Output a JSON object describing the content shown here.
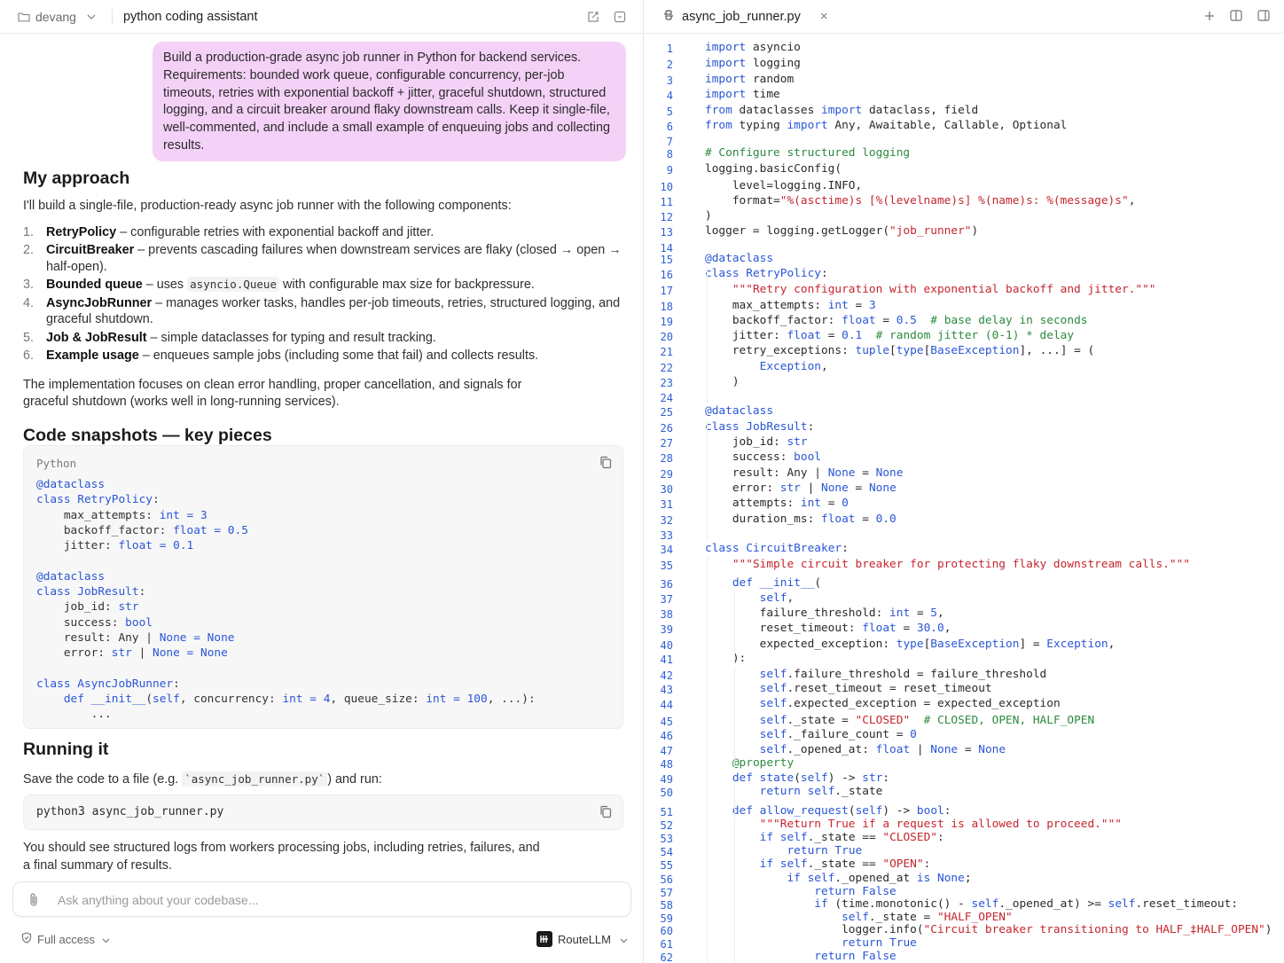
{
  "left_header": {
    "workspace": "devang",
    "chat_title": "python coding assistant"
  },
  "user_message": "Build a production-grade async job runner in Python for backend services. Requirements: bounded work queue, configurable concurrency, per-job timeouts, retries with exponential backoff + jitter, graceful shutdown, structured logging, and a circuit breaker around flaky downstream calls. Keep it single-file, well-commented, and include a small example of enqueuing jobs and collecting results.",
  "answer": {
    "approach_heading": "My approach",
    "intro": "I'll build a single-file, production-ready async job runner with the following components:",
    "steps": [
      {
        "num": "1.",
        "title": "RetryPolicy",
        "text": " – configurable retries with exponential backoff and jitter."
      },
      {
        "num": "2.",
        "title": "CircuitBreaker",
        "text": " – prevents cascading failures when downstream services are flaky (closed → open → half-open)."
      },
      {
        "num": "3.",
        "title": "Bounded queue",
        "text_before": " – uses ",
        "code": "asyncio.Queue",
        "text": " with configurable max size for backpressure."
      },
      {
        "num": "4.",
        "title": "AsyncJobRunner",
        "text": " – manages worker tasks, handles per-job timeouts, retries, structured logging, and graceful shutdown."
      },
      {
        "num": "5.",
        "title": "Job & JobResult",
        "text": " – simple dataclasses for typing and result tracking."
      },
      {
        "num": "6.",
        "title": "Example usage",
        "text": " – enqueues sample jobs (including some that fail) and collects results."
      }
    ],
    "summary": "The implementation focuses on clean error handling, proper cancellation, and signals for graceful shutdown (works well in long-running services).",
    "snapshots_heading": "Code snapshots — key pieces",
    "code_language": "Python",
    "running_heading": "Running it",
    "run_before": "Save the code to a file (e.g. ",
    "run_code": "`async_job_runner.py`",
    "run_after": ") and run:",
    "command": "python3 async_job_runner.py",
    "closing": "You should see structured logs from workers processing jobs, including retries, failures, and a final summary of results."
  },
  "composer": {
    "placeholder": "Ask anything about your codebase..."
  },
  "footer": {
    "access": "Full access",
    "model": "RouteLLM"
  },
  "editor": {
    "filename": "async_job_runner.py"
  }
}
